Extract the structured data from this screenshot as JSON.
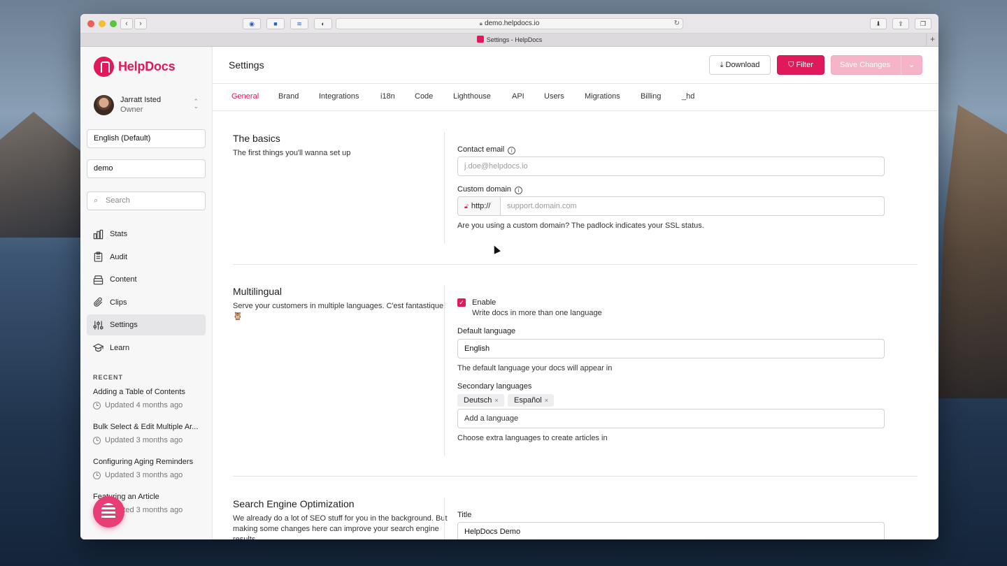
{
  "browser": {
    "url": "demo.helpdocs.io",
    "tab_title": "Settings - HelpDocs"
  },
  "brand": {
    "name": "HelpDocs",
    "accent": "#e0195a"
  },
  "user": {
    "name": "Jarratt Isted",
    "role": "Owner"
  },
  "sidebar": {
    "language": "English (Default)",
    "workspace": "demo",
    "search_placeholder": "Search",
    "nav": [
      {
        "label": "Stats",
        "icon": "bar-chart-icon"
      },
      {
        "label": "Audit",
        "icon": "clipboard-icon"
      },
      {
        "label": "Content",
        "icon": "archive-icon"
      },
      {
        "label": "Clips",
        "icon": "paperclip-icon"
      },
      {
        "label": "Settings",
        "icon": "sliders-icon",
        "active": true
      },
      {
        "label": "Learn",
        "icon": "graduation-cap-icon"
      }
    ],
    "recent_heading": "RECENT",
    "recent": [
      {
        "title": "Adding a Table of Contents",
        "updated": "Updated 4 months ago"
      },
      {
        "title": "Bulk Select & Edit Multiple Ar...",
        "updated": "Updated 3 months ago"
      },
      {
        "title": "Configuring Aging Reminders",
        "updated": "Updated 3 months ago"
      },
      {
        "title": "Featuring an Article",
        "updated": "Updated 3 months ago"
      }
    ]
  },
  "header": {
    "title": "Settings",
    "download_label": "Download",
    "filter_label": "Filter",
    "save_label": "Save Changes"
  },
  "tabs": [
    "General",
    "Brand",
    "Integrations",
    "i18n",
    "Code",
    "Lighthouse",
    "API",
    "Users",
    "Migrations",
    "Billing",
    "_hd"
  ],
  "basics": {
    "title": "The basics",
    "desc": "The first things you'll wanna set up",
    "contact_label": "Contact email",
    "contact_placeholder": "j.doe@helpdocs.io",
    "domain_label": "Custom domain",
    "domain_prefix": "http://",
    "domain_placeholder": "support.domain.com",
    "domain_help": "Are you using a custom domain? The padlock indicates your SSL status."
  },
  "multilingual": {
    "title": "Multilingual",
    "desc": "Serve your customers in multiple languages. C'est fantastique! 🦉",
    "enable_label": "Enable",
    "enable_help": "Write docs in more than one language",
    "default_label": "Default language",
    "default_value": "English",
    "default_help": "The default language your docs will appear in",
    "secondary_label": "Secondary languages",
    "secondary_chips": [
      "Deutsch",
      "Español"
    ],
    "add_placeholder": "Add a language",
    "secondary_help": "Choose extra languages to create articles in"
  },
  "seo": {
    "title": "Search Engine Optimization",
    "desc": "We already do a lot of SEO stuff for you in the background. But making some changes here can improve your search engine results.",
    "title_label": "Title",
    "title_value": "HelpDocs Demo"
  }
}
